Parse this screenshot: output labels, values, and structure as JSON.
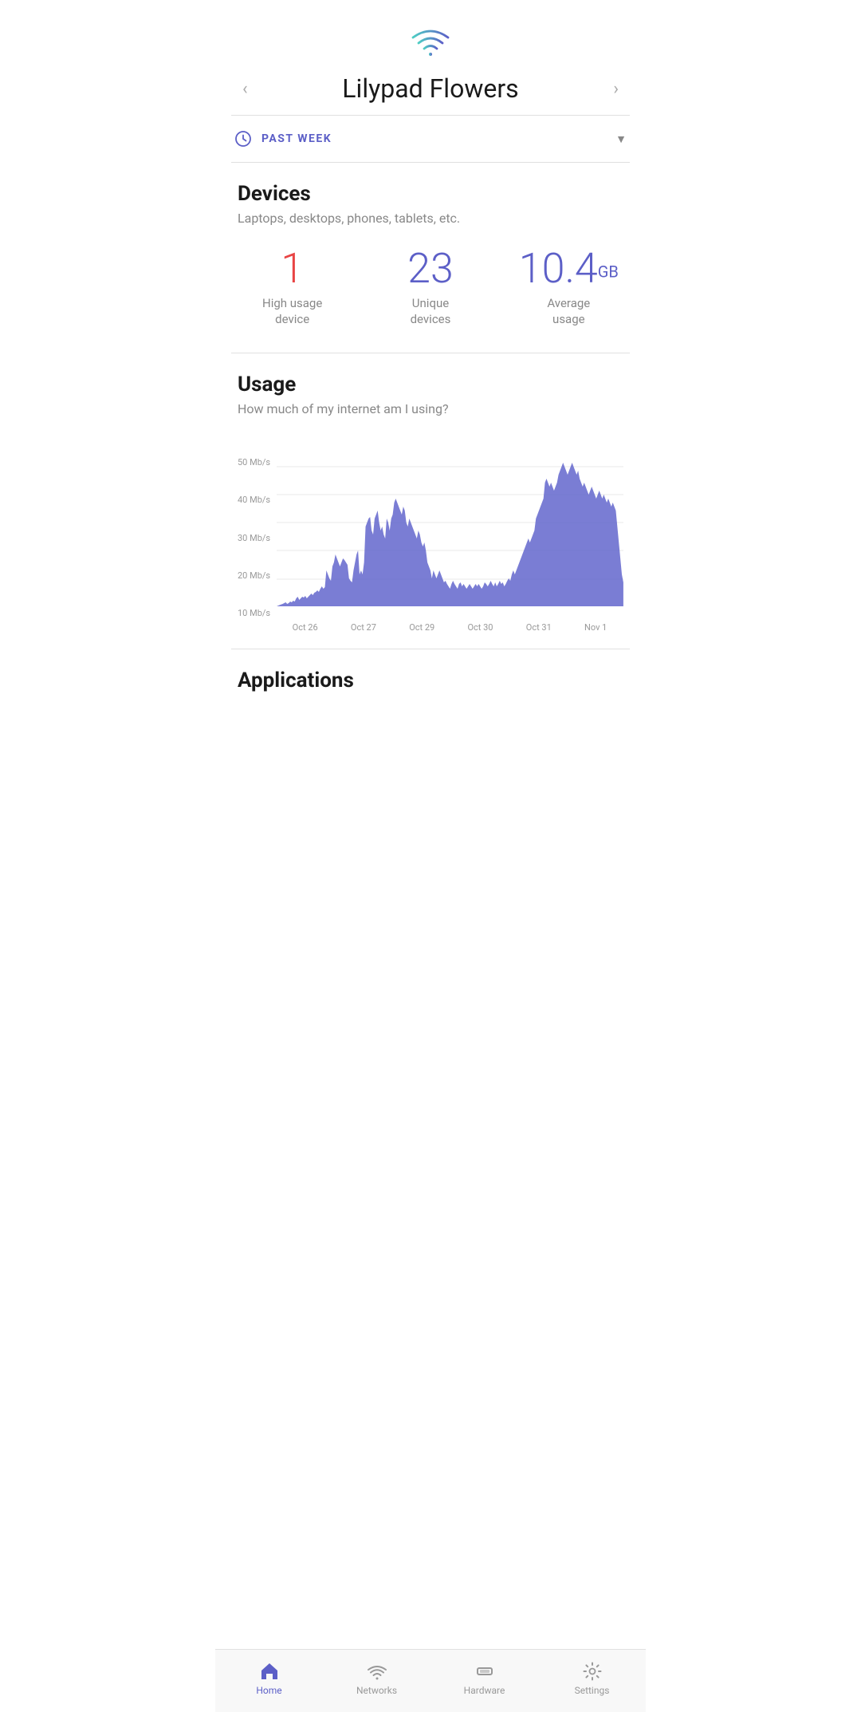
{
  "header": {
    "title": "Lilypad Flowers",
    "prev_label": "‹",
    "next_label": "›"
  },
  "period": {
    "label": "PAST WEEK"
  },
  "devices": {
    "title": "Devices",
    "subtitle": "Laptops, desktops, phones, tablets, etc.",
    "stats": [
      {
        "value": "1",
        "label": "High usage\ndevice",
        "color": "red"
      },
      {
        "value": "23",
        "label": "Unique\ndevices",
        "color": "purple"
      },
      {
        "value": "10.4",
        "unit": "GB",
        "label": "Average\nusage",
        "color": "purple"
      }
    ]
  },
  "usage": {
    "title": "Usage",
    "subtitle": "How much of my internet am I using?",
    "y_labels": [
      "10 Mb/s",
      "20 Mb/s",
      "30 Mb/s",
      "40 Mb/s",
      "50 Mb/s"
    ],
    "x_labels": [
      "Oct 26",
      "Oct 27",
      "Oct 29",
      "Oct 30",
      "Oct 31",
      "Nov 1"
    ]
  },
  "applications": {
    "title": "Applications"
  },
  "bottom_nav": [
    {
      "id": "home",
      "label": "Home",
      "active": true
    },
    {
      "id": "networks",
      "label": "Networks",
      "active": false
    },
    {
      "id": "hardware",
      "label": "Hardware",
      "active": false
    },
    {
      "id": "settings",
      "label": "Settings",
      "active": false
    }
  ],
  "colors": {
    "accent": "#5c5fc7",
    "red": "#e84444",
    "gray": "#888888",
    "wifi_gradient_start": "#4ecdc4",
    "wifi_gradient_end": "#5c5fc7"
  }
}
